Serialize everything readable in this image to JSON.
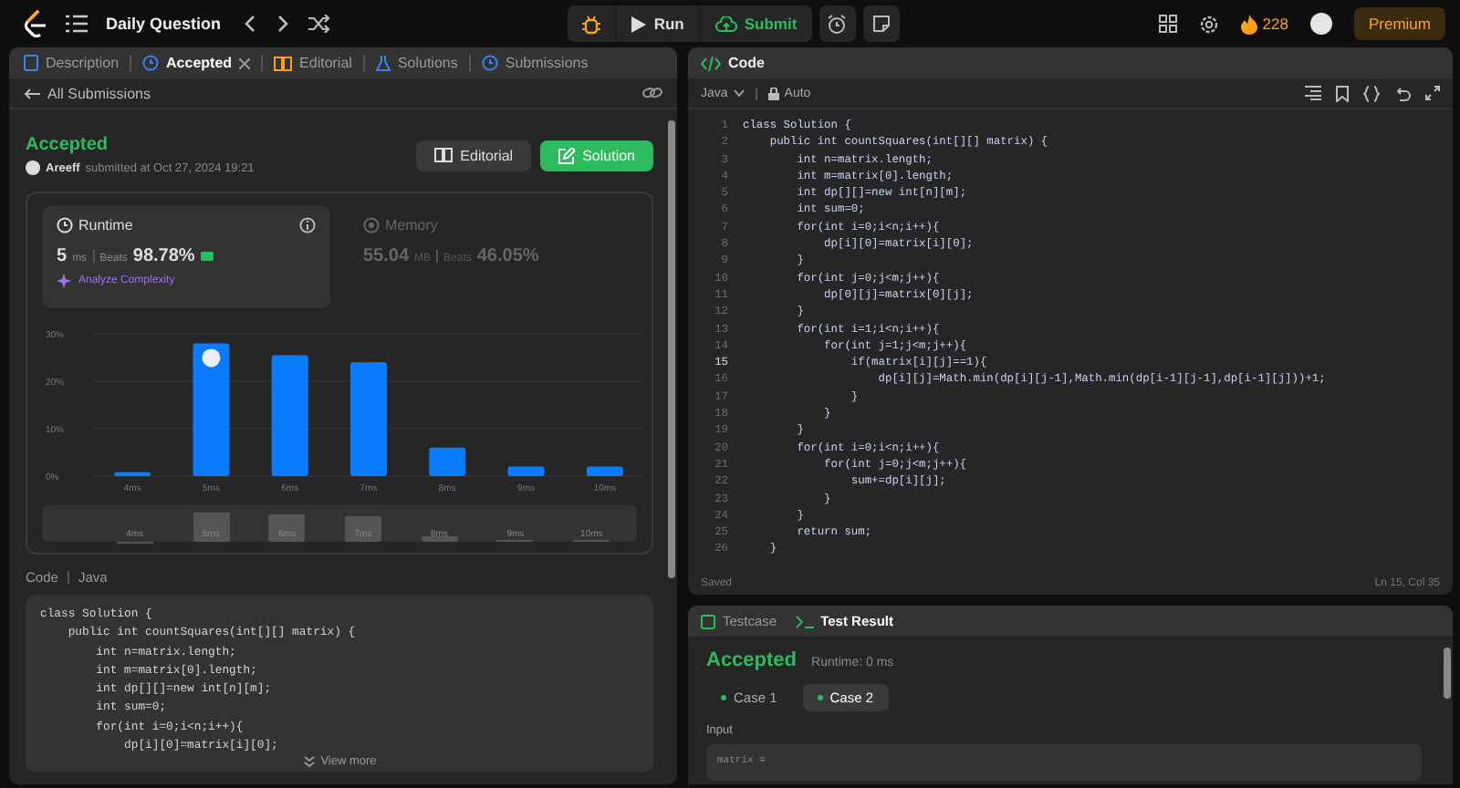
{
  "top_bar": {
    "title": "Daily Question",
    "run": "Run",
    "submit": "Submit",
    "streak": "228",
    "premium": "Premium"
  },
  "left_panel": {
    "tabs": [
      {
        "label": "Description",
        "selected": false,
        "closable": false
      },
      {
        "label": "Accepted",
        "selected": true,
        "closable": true
      },
      {
        "label": "Editorial",
        "selected": false,
        "closable": false
      },
      {
        "label": "Solutions",
        "selected": false,
        "closable": false
      },
      {
        "label": "Submissions",
        "selected": false,
        "closable": false
      }
    ],
    "back_link": "All Submissions",
    "submission": {
      "status": "Accepted",
      "user": "Areeff",
      "submitted": "submitted at Oct 27, 2024 19:21",
      "editorial_button": "Editorial",
      "solution_button": "Solution"
    },
    "stats": [
      {
        "title": "Runtime",
        "value": "5",
        "unit": "ms",
        "beats_label": "Beats",
        "beats": "98.78%",
        "selected": true,
        "extra": "Analyze Complexity"
      },
      {
        "title": "Memory",
        "value": "55.04",
        "unit": "MB",
        "beats_label": "Beats",
        "beats": "46.05%",
        "selected": false
      }
    ],
    "chart_data": {
      "type": "bar",
      "categories": [
        "4ms",
        "5ms",
        "6ms",
        "7ms",
        "8ms",
        "9ms",
        "10ms"
      ],
      "values": [
        0.8,
        28,
        25.5,
        24,
        6,
        2,
        2
      ],
      "ylim": [
        0,
        30
      ],
      "yticks": [
        {
          "value": 0,
          "label": "0%"
        },
        {
          "value": 10,
          "label": "10%"
        },
        {
          "value": 20,
          "label": "20%"
        },
        {
          "value": 30,
          "label": "30%"
        }
      ]
    },
    "navigator_labels": [
      "4ms",
      "5ms",
      "6ms",
      "7ms",
      "8ms",
      "9ms",
      "10ms"
    ],
    "code_header": {
      "label": "Code",
      "language": "Java"
    },
    "code_preview": [
      "class Solution {",
      "    public int countSquares(int[][] matrix) {",
      "        int n=matrix.length;",
      "        int m=matrix[0].length;",
      "        int dp[][]=new int[n][m];",
      "        int sum=0;",
      "        for(int i=0;i<n;i++){",
      "            dp[i][0]=matrix[i][0];"
    ],
    "view_more": "View more"
  },
  "editor": {
    "title": "Code",
    "language": "Java",
    "mode": "Auto",
    "lines": [
      {
        "n": "1",
        "text": "class Solution {",
        "current": false
      },
      {
        "n": "2",
        "text": "    public int countSquares(int[][] matrix) {",
        "current": false
      },
      {
        "n": "3",
        "text": "        int n=matrix.length;",
        "current": false
      },
      {
        "n": "4",
        "text": "        int m=matrix[0].length;",
        "current": false
      },
      {
        "n": "5",
        "text": "        int dp[][]=new int[n][m];",
        "current": false
      },
      {
        "n": "6",
        "text": "        int sum=0;",
        "current": false
      },
      {
        "n": "7",
        "text": "        for(int i=0;i<n;i++){",
        "current": false
      },
      {
        "n": "8",
        "text": "            dp[i][0]=matrix[i][0];",
        "current": false
      },
      {
        "n": "9",
        "text": "        }",
        "current": false
      },
      {
        "n": "10",
        "text": "        for(int j=0;j<m;j++){",
        "current": false
      },
      {
        "n": "11",
        "text": "            dp[0][j]=matrix[0][j];",
        "current": false
      },
      {
        "n": "12",
        "text": "        }",
        "current": false
      },
      {
        "n": "13",
        "text": "        for(int i=1;i<n;i++){",
        "current": false
      },
      {
        "n": "14",
        "text": "            for(int j=1;j<m;j++){",
        "current": false
      },
      {
        "n": "15",
        "text": "                if(matrix[i][j]==1){",
        "current": true
      },
      {
        "n": "16",
        "text": "                    dp[i][j]=Math.min(dp[i][j-1],Math.min(dp[i-1][j-1],dp[i-1][j]))+1;",
        "current": false
      },
      {
        "n": "17",
        "text": "                }",
        "current": false
      },
      {
        "n": "18",
        "text": "            }",
        "current": false
      },
      {
        "n": "19",
        "text": "        }",
        "current": false
      },
      {
        "n": "20",
        "text": "        for(int i=0;i<n;i++){",
        "current": false
      },
      {
        "n": "21",
        "text": "            for(int j=0;j<m;j++){",
        "current": false
      },
      {
        "n": "22",
        "text": "                sum+=dp[i][j];",
        "current": false
      },
      {
        "n": "23",
        "text": "            }",
        "current": false
      },
      {
        "n": "24",
        "text": "        }",
        "current": false
      },
      {
        "n": "25",
        "text": "        return sum;",
        "current": false
      },
      {
        "n": "26",
        "text": "    }",
        "current": false
      }
    ],
    "status": "Saved",
    "cursor": "Ln 15, Col 35"
  },
  "bottom_panel": {
    "tabs": [
      {
        "label": "Testcase",
        "selected": false
      },
      {
        "label": "Test Result",
        "selected": true
      }
    ],
    "result": "Accepted",
    "runtime": "Runtime: 0 ms",
    "cases": [
      {
        "label": "Case 1",
        "selected": false
      },
      {
        "label": "Case 2",
        "selected": true
      }
    ],
    "input_label": "Input",
    "input_value": "matrix ="
  }
}
